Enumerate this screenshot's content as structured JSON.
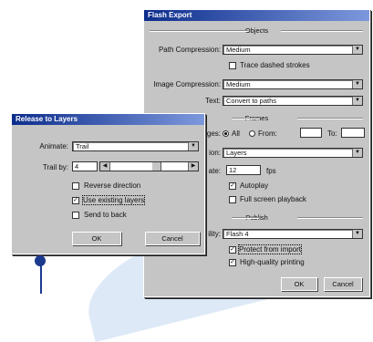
{
  "flash_export": {
    "title": "Flash Export",
    "objects_title": "Objects",
    "path_compression_label": "Path Compression:",
    "path_compression_value": "Medium",
    "trace_dashed_label": "Trace dashed strokes",
    "image_compression_label": "Image Compression:",
    "image_compression_value": "Medium",
    "text_label": "Text:",
    "text_value": "Convert to paths",
    "frames_title": "Frames",
    "pages_label": "ges:",
    "all_label": "All",
    "from_label": "From:",
    "to_label": "To:",
    "from_value": "",
    "to_value": "",
    "frames_from_label": "ion:",
    "frames_from_value": "Layers",
    "frame_rate_label": "ate:",
    "frame_rate_value": "12",
    "fps_label": "fps",
    "autoplay_label": "Autoplay",
    "fullscreen_label": "Full screen playback",
    "publish_title": "Publish",
    "compat_label": "ility:",
    "compat_value": "Flash 4",
    "protect_label": "Protect from import",
    "highquality_label": "High-quality printing",
    "ok_label": "OK",
    "cancel_label": "Cancel"
  },
  "release_layers": {
    "title": "Release to Layers",
    "animate_label": "Animate:",
    "animate_value": "Trail",
    "trail_by_label": "Trail by:",
    "trail_by_value": "4",
    "reverse_label": "Reverse direction",
    "use_existing_label": "Use existing layers",
    "send_back_label": "Send to back",
    "ok_label": "OK",
    "cancel_label": "Cancel"
  },
  "state": {
    "trace_dashed": false,
    "all_selected": true,
    "autoplay": true,
    "fullscreen": false,
    "protect": true,
    "highquality": true,
    "reverse": false,
    "use_existing": true,
    "send_back": false,
    "trail_slider_level": 0.6
  },
  "icons": {
    "dropdown": "chevron-down-icon",
    "slider_left": "arrow-left-icon",
    "slider_right": "arrow-right-icon",
    "check": "check-icon"
  },
  "colors": {
    "title_gradient_start": "#0c2d8c",
    "title_gradient_end": "#7d98dc",
    "dialog_face": "#c5c5c5",
    "callout": "#1b3a8e"
  }
}
